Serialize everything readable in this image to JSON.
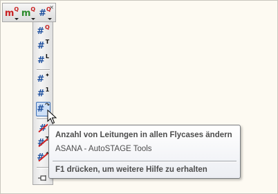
{
  "top_toolbar": {
    "buttons": [
      {
        "name": "m-q-red",
        "glyph": "m",
        "sup": "Q",
        "glyph_color": "#c82020"
      },
      {
        "name": "m-q-green",
        "glyph": "m",
        "sup": "Q",
        "glyph_color": "#2a8a2a"
      },
      {
        "name": "hash-q",
        "glyph": "#",
        "sup": "Q",
        "glyph_color": "#1d4f9e"
      }
    ],
    "close_glyph": "×"
  },
  "vertical_toolbar": {
    "buttons": [
      {
        "glyph": "#",
        "sub": "Q"
      },
      {
        "glyph": "#",
        "sub": "T"
      },
      {
        "glyph": "#",
        "sub": "L"
      },
      {
        "glyph": "#",
        "sub": "✦"
      },
      {
        "glyph": "#",
        "sub": "1"
      },
      {
        "glyph": "#",
        "sub": "↷"
      },
      {
        "glyph": "#",
        "sub": ""
      },
      {
        "glyph": "#",
        "sub": "T"
      },
      {
        "glyph": "#",
        "sub": "✦"
      }
    ]
  },
  "tooltip": {
    "title": "Anzahl von Leitungen in allen Flycases ändern",
    "description": "ASANA - AutoSTAGE Tools",
    "help": "F1 drücken, um weitere Hilfe zu erhalten"
  },
  "colors": {
    "background": "#fdfaf2",
    "accent_blue": "#1d4f9e",
    "strike_red": "#d02020"
  }
}
